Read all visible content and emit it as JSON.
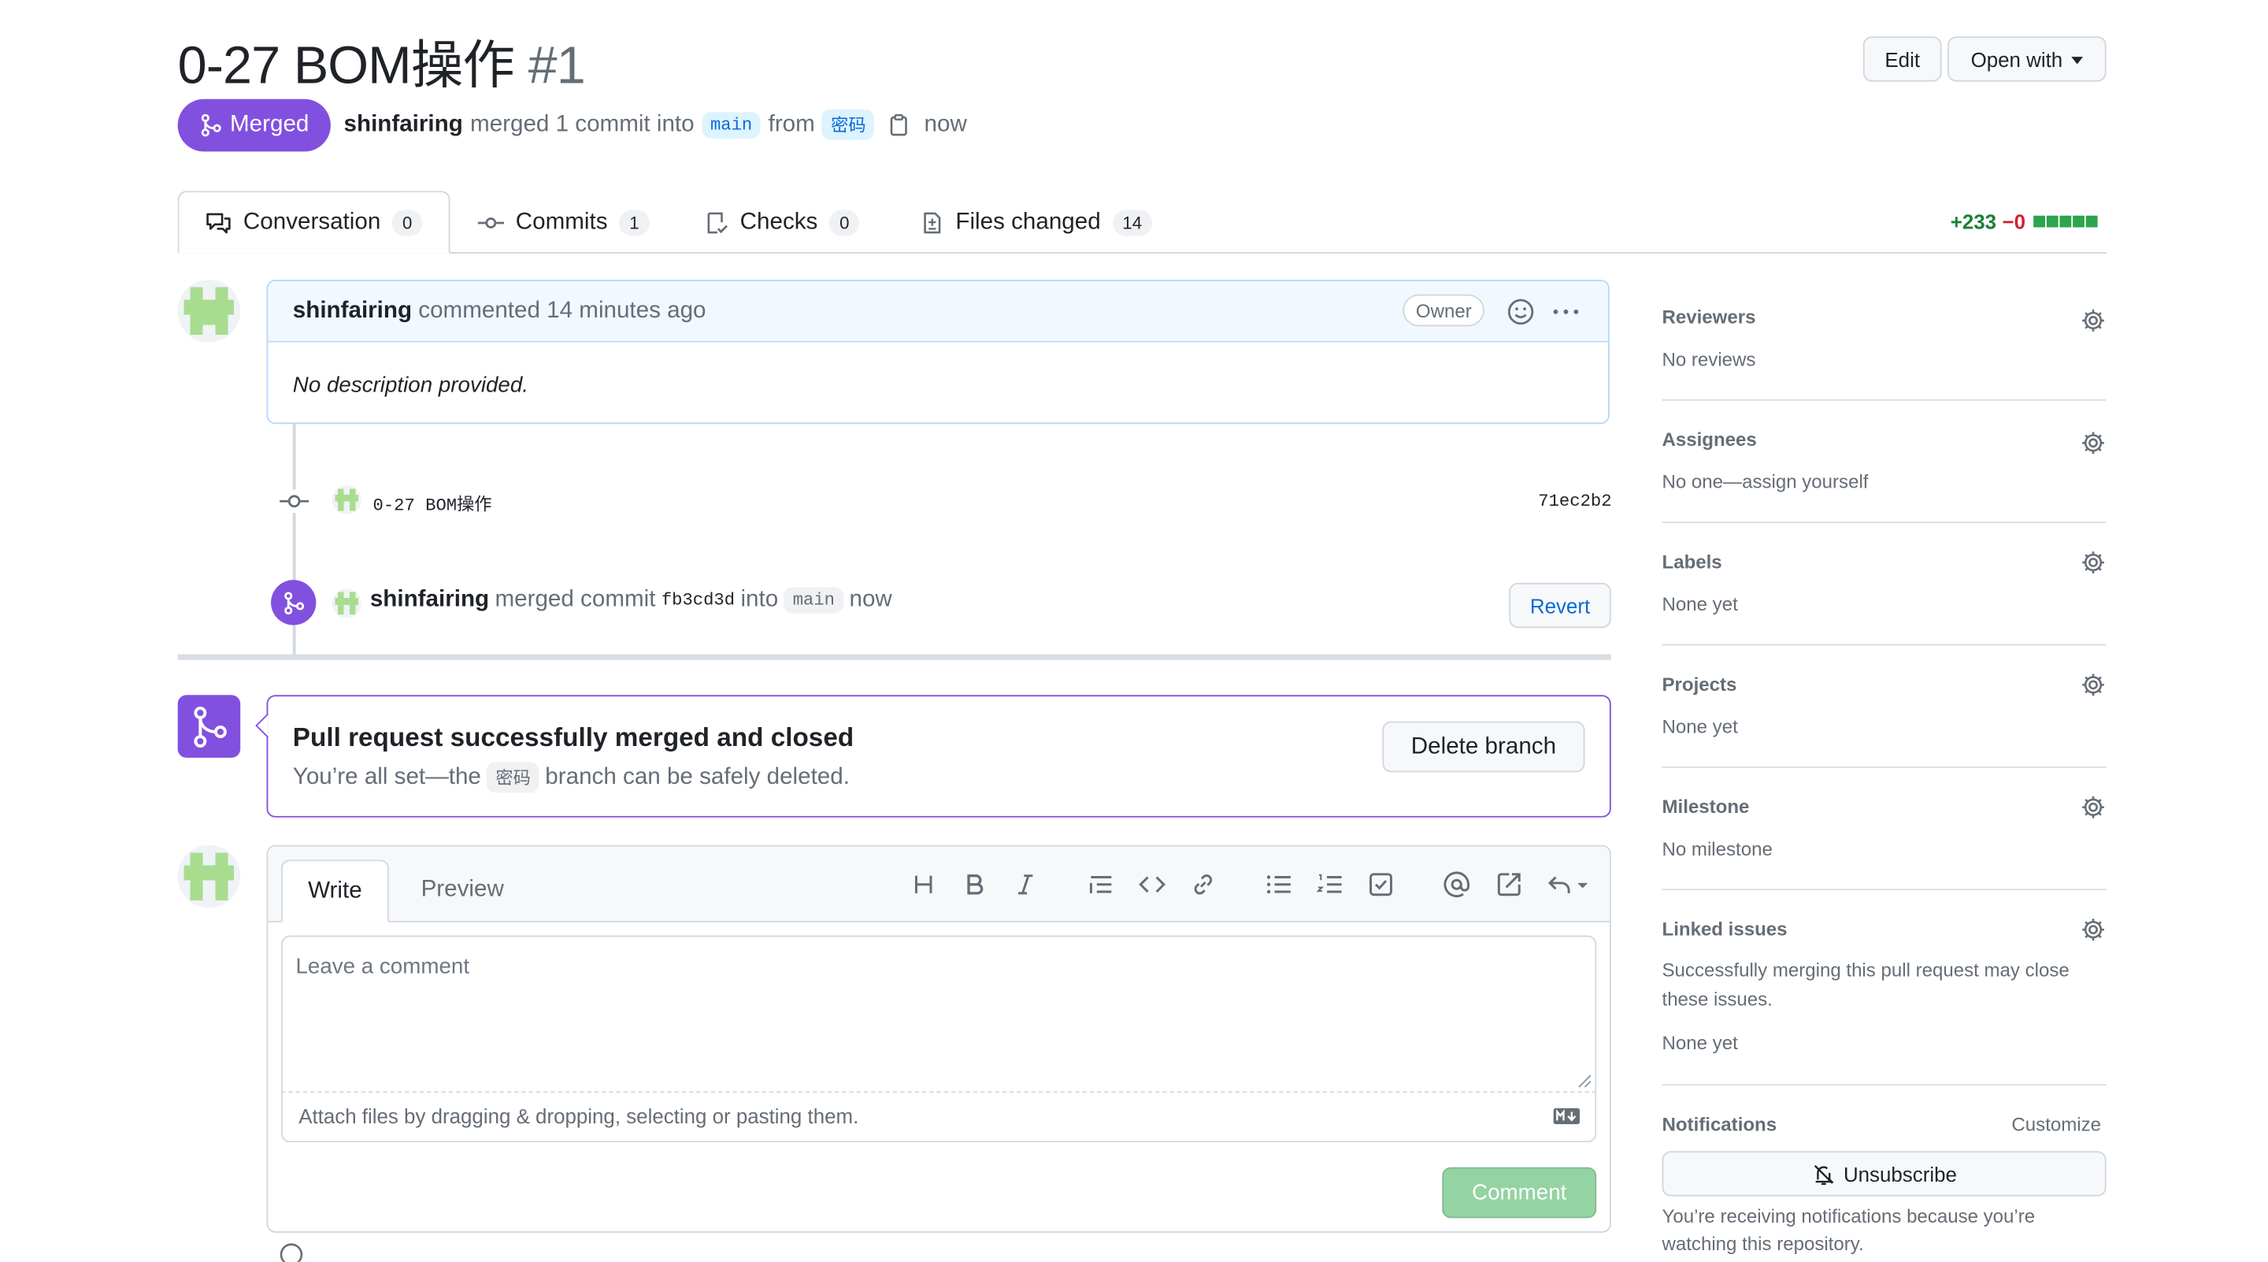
{
  "pr": {
    "title": "0-27 BOM操作",
    "number": "#1",
    "status": "Merged",
    "author": "shinfairing",
    "merge_text": "merged 1 commit into",
    "base_branch": "main",
    "from_text": "from",
    "head_branch": "密码",
    "time": "now"
  },
  "header": {
    "edit_label": "Edit",
    "open_with_label": "Open with"
  },
  "tabs": [
    {
      "label": "Conversation",
      "count": "0"
    },
    {
      "label": "Commits",
      "count": "1"
    },
    {
      "label": "Checks",
      "count": "0"
    },
    {
      "label": "Files changed",
      "count": "14"
    }
  ],
  "diffstat": {
    "additions": "+233",
    "deletions": "−0"
  },
  "comment": {
    "author": "shinfairing",
    "action": "commented 14 minutes ago",
    "badge": "Owner",
    "body": "No description provided."
  },
  "commit_event": {
    "message": "0-27 BOM操作",
    "sha": "71ec2b2"
  },
  "merge_event": {
    "author": "shinfairing",
    "text": "merged commit",
    "sha": "fb3cd3d",
    "into": "into",
    "branch": "main",
    "time": "now",
    "revert_label": "Revert"
  },
  "merged_box": {
    "title": "Pull request successfully merged and closed",
    "sub_prefix": "You’re all set—the",
    "branch": "密码",
    "sub_suffix": "branch can be safely deleted.",
    "delete_label": "Delete branch"
  },
  "form": {
    "write_tab": "Write",
    "preview_tab": "Preview",
    "placeholder": "Leave a comment",
    "attach_text": "Attach files by dragging & dropping, selecting or pasting them.",
    "submit_label": "Comment"
  },
  "sidebar": {
    "reviewers": {
      "title": "Reviewers",
      "value": "No reviews"
    },
    "assignees": {
      "title": "Assignees",
      "value": "No one—assign yourself"
    },
    "labels": {
      "title": "Labels",
      "value": "None yet"
    },
    "projects": {
      "title": "Projects",
      "value": "None yet"
    },
    "milestone": {
      "title": "Milestone",
      "value": "No milestone"
    },
    "linked_issues": {
      "title": "Linked issues",
      "desc_line1": "Successfully merging this pull request may close",
      "desc_line2": "these issues.",
      "value": "None yet"
    },
    "notifications": {
      "title": "Notifications",
      "customize": "Customize",
      "unsubscribe": "Unsubscribe",
      "reason_line1": "You’re receiving notifications because you’re",
      "reason_line2": "watching this repository."
    }
  },
  "colors": {
    "merged": "#8250df",
    "accent": "#0969da",
    "add": "#1a7f37",
    "del": "#cf222e"
  }
}
